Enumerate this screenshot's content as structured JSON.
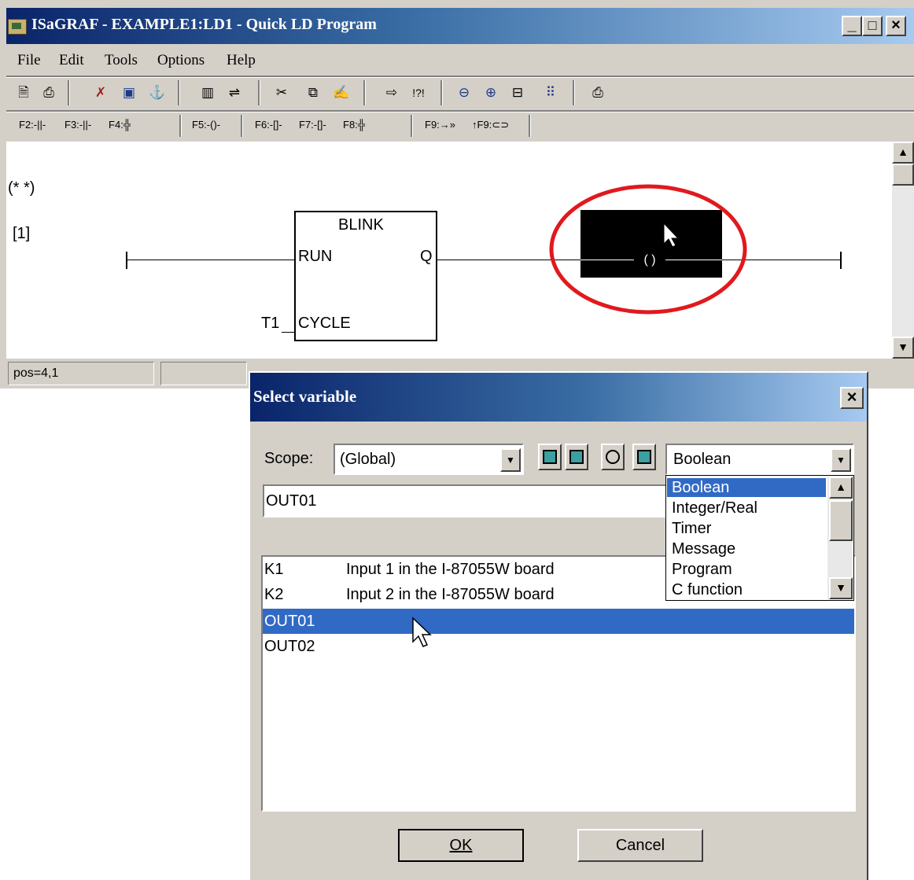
{
  "window": {
    "title": "ISaGRAF - EXAMPLE1:LD1 - Quick LD Program",
    "caption_buttons": {
      "minimize": "_",
      "maximize": "□",
      "close": "×"
    }
  },
  "menu": [
    "File",
    "Edit",
    "Tools",
    "Options",
    "Help"
  ],
  "toolbar": {
    "icons": [
      "new-doc-icon",
      "print-preview-icon",
      "cut-variable-icon",
      "dictionary-icon",
      "connect-icon",
      "library-icon",
      "link-icon",
      "scissors-icon",
      "copy-icon",
      "paste-icon",
      "goto-icon",
      "find-icon",
      "zoom-out-icon",
      "zoom-in-icon",
      "fit-icon",
      "grid-icon",
      "print-icon"
    ]
  },
  "fkeys": {
    "f2": "F2:",
    "f3": "F3:",
    "f4": "F4:",
    "f5": "F5:",
    "f6": "F6:",
    "f7": "F7:",
    "f8": "F8:",
    "f9": "F9:",
    "sf9": "↑F9:"
  },
  "ladder": {
    "comment": "(* *)",
    "rung_label": "[1]",
    "block_name": "BLINK",
    "input1": "RUN",
    "input2": "CYCLE",
    "output": "Q",
    "cycle_var": "T1"
  },
  "status": {
    "position": "pos=4,1"
  },
  "dialog": {
    "title": "Select variable",
    "close": "×",
    "scope_label": "Scope:",
    "scope_value": "(Global)",
    "type_value": "Boolean",
    "name_value": "OUT01",
    "type_options": [
      "Boolean",
      "Integer/Real",
      "Timer",
      "Message",
      "Program",
      "C function"
    ],
    "selected_type_index": 0,
    "variables": [
      {
        "name": "K1",
        "comment": "Input 1 in the I-87055W board"
      },
      {
        "name": "K2",
        "comment": "Input 2 in the I-87055W board"
      },
      {
        "name": "OUT01",
        "comment": ""
      },
      {
        "name": "OUT02",
        "comment": ""
      }
    ],
    "selected_variable_index": 2,
    "ok_label": "OK",
    "cancel_label": "Cancel"
  }
}
